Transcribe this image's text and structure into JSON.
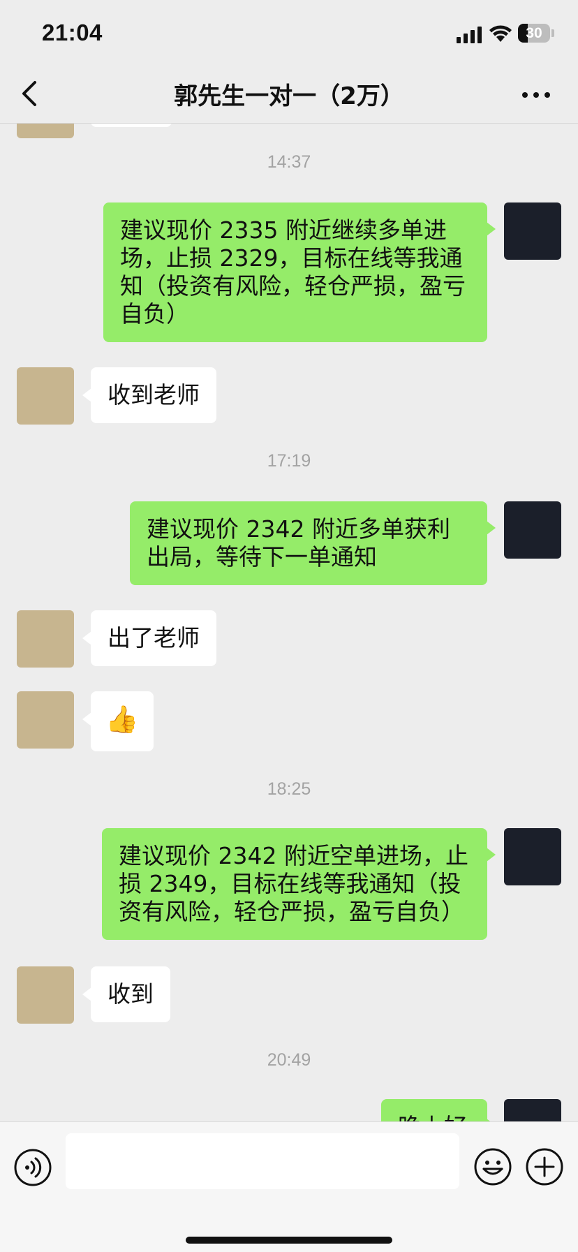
{
  "status_bar": {
    "time": "21:04",
    "battery": "30",
    "battery_level": 0.3
  },
  "nav": {
    "title": "郭先生一对一（2万）"
  },
  "messages": [
    {
      "type": "time",
      "text": "14:37"
    },
    {
      "type": "msg",
      "side": "right",
      "sender": "teacher",
      "text": "建议现价 2335 附近继续多单进场，止损 2329，目标在线等我通知（投资有风险，轻仓严损，盈亏自负）"
    },
    {
      "type": "msg",
      "side": "left",
      "sender": "user",
      "text": "收到老师"
    },
    {
      "type": "time",
      "text": "17:19"
    },
    {
      "type": "msg",
      "side": "right",
      "sender": "teacher",
      "text": "建议现价 2342 附近多单获利出局，等待下一单通知"
    },
    {
      "type": "msg",
      "side": "left",
      "sender": "user",
      "text": "出了老师"
    },
    {
      "type": "msg",
      "side": "left",
      "sender": "user",
      "text": "👍"
    },
    {
      "type": "time",
      "text": "18:25"
    },
    {
      "type": "msg",
      "side": "right",
      "sender": "teacher",
      "text": "建议现价 2342 附近空单进场，止损 2349，目标在线等我通知（投资有风险，轻仓严损，盈亏自负）"
    },
    {
      "type": "msg",
      "side": "left",
      "sender": "user",
      "text": "收到"
    },
    {
      "type": "time",
      "text": "20:49"
    },
    {
      "type": "msg",
      "side": "right",
      "sender": "teacher",
      "text": "晚上好"
    }
  ],
  "input": {
    "value": "",
    "placeholder": ""
  },
  "icons": {
    "back": "chevron-left-icon",
    "more": "more-dots-icon",
    "voice": "voice-icon",
    "emoji": "emoji-icon",
    "plus": "plus-circle-icon"
  },
  "colors": {
    "right_bubble": "#95ec69",
    "left_bubble": "#ffffff",
    "background": "#ededed"
  }
}
